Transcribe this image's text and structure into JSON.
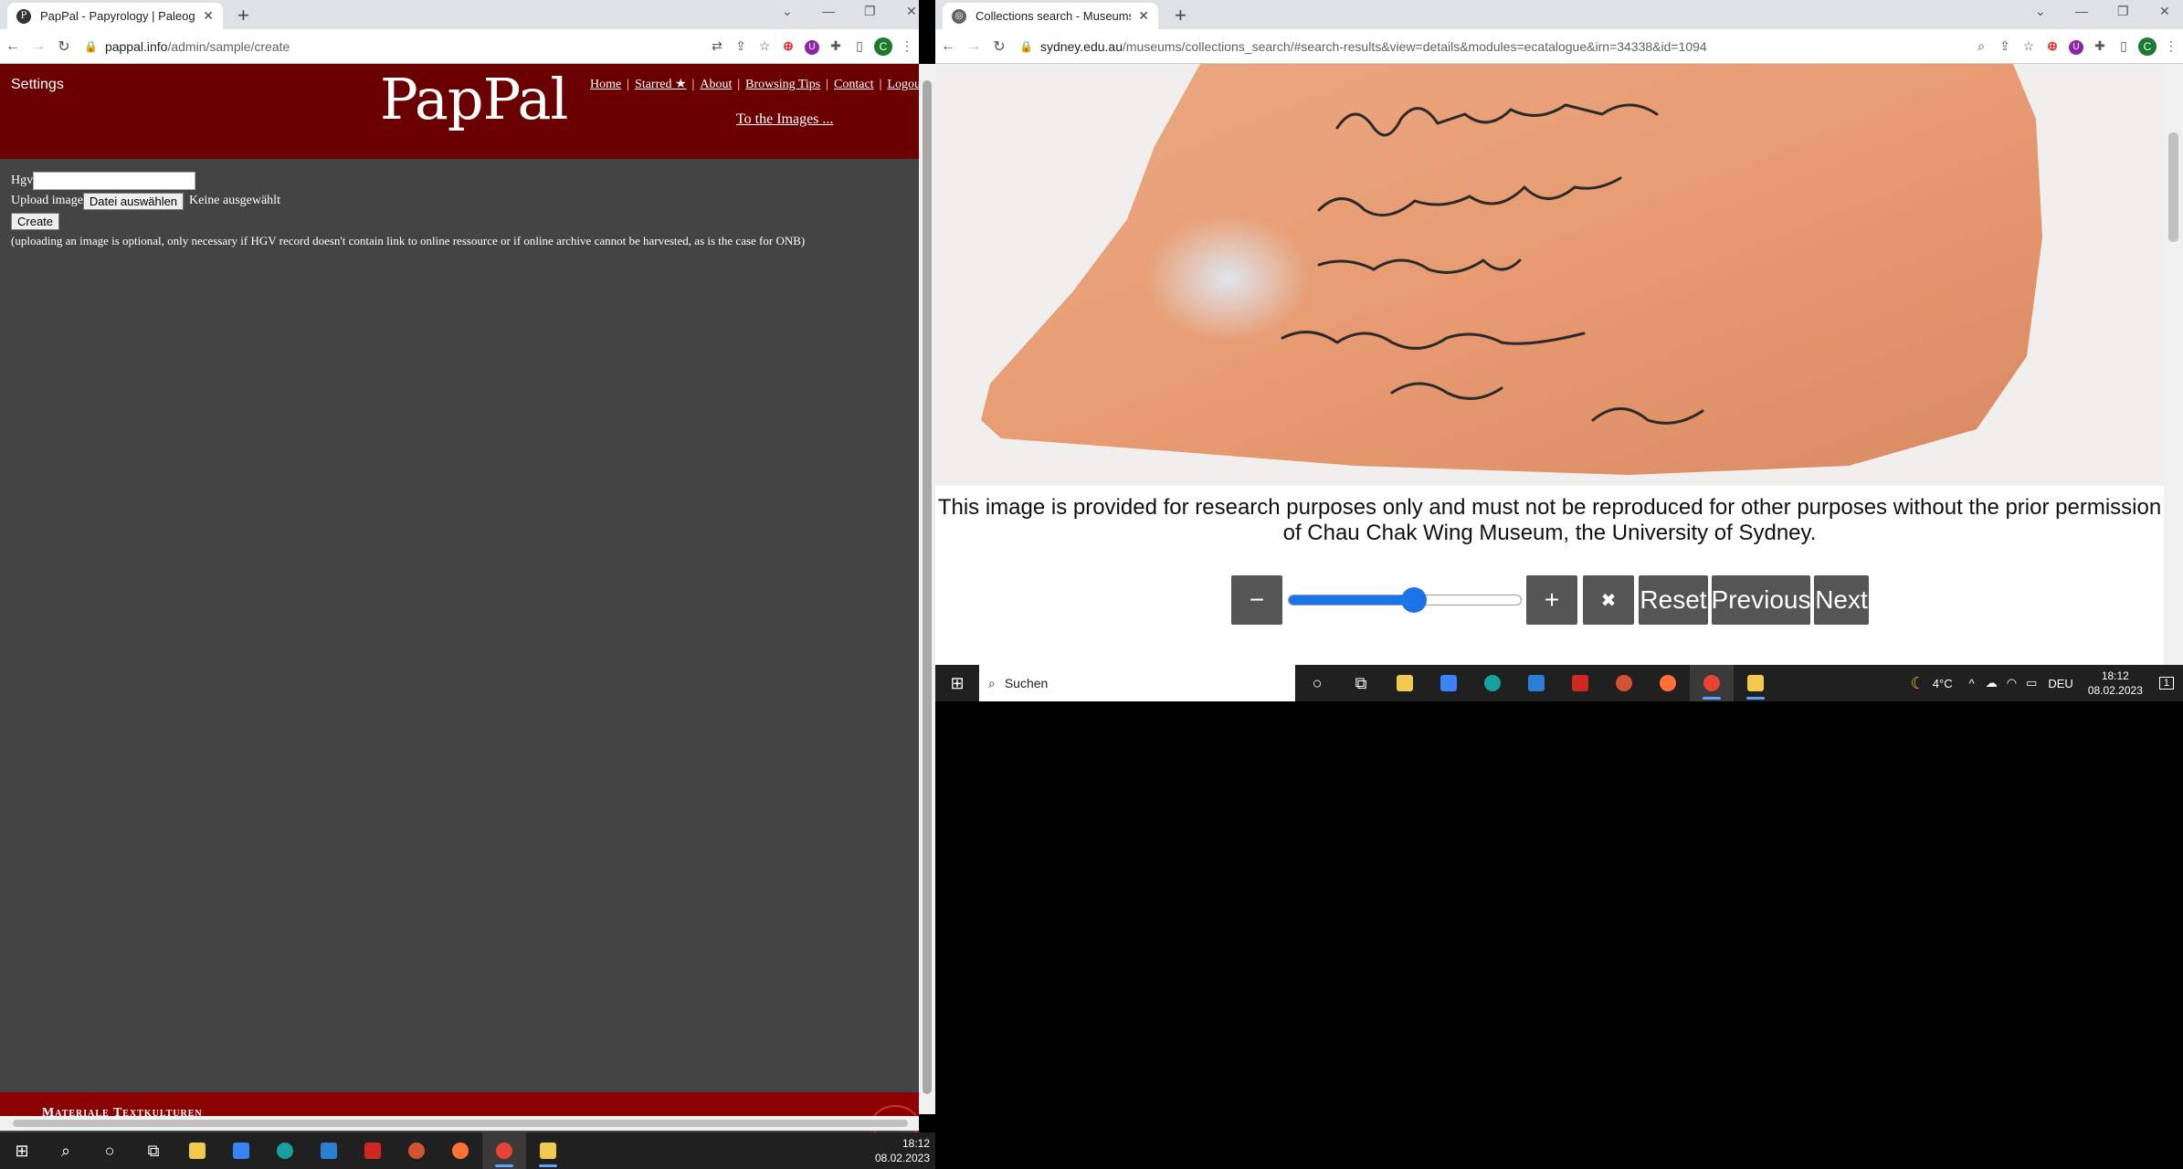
{
  "left_browser": {
    "tab_title": "PapPal - Papyrology | Paleograph",
    "url_host": "pappal.info",
    "url_path": "/admin/sample/create",
    "page": {
      "settings_label": "Settings",
      "logo": "PapPal",
      "nav": [
        "Home",
        "Starred ★",
        "About",
        "Browsing Tips",
        "Contact",
        "Logout"
      ],
      "nav_separator": "|",
      "to_images": "To the Images ...",
      "form": {
        "hgv_label": "Hgv",
        "hgv_value": "",
        "upload_label": "Upload image",
        "file_button": "Datei auswählen",
        "file_status": "Keine ausgewählt",
        "create_button": "Create",
        "note": "(uploading an image is optional, only necessary if HGV record doesn't contain link to online ressource or if online archive cannot be harvested, as is the case for ONB)"
      },
      "footer_text": "Materiale Textkulturen"
    },
    "profile_initial": "C"
  },
  "right_browser": {
    "tab_title": "Collections search - Museums - T",
    "url_host": "sydney.edu.au",
    "url_path": "/museums/collections_search/#search-results&view=details&modules=ecatalogue&irn=34338&id=1094",
    "caption": "This image is provided for research purposes only and must not be reproduced for other purposes without the prior permission of Chau Chak Wing Museum, the University of Sydney.",
    "controls": {
      "zoom_out": "−",
      "zoom_in": "+",
      "fullscreen_icon": "✖",
      "reset": "Reset",
      "previous": "Previous",
      "next": "Next",
      "zoom_level_fraction": 0.54
    },
    "profile_initial": "C"
  },
  "taskbar_left": {
    "time": "18:12",
    "date": "08.02.2023"
  },
  "taskbar_right": {
    "search_placeholder": "Suchen",
    "weather": "4°C",
    "language": "DEU",
    "time": "18:12",
    "date": "08.02.2023",
    "notification_count": "1"
  },
  "colors": {
    "pappal_red": "#6b0000",
    "page_bg": "#444444",
    "slider_blue": "#1a73e8",
    "ostracon": "#e8a07a"
  }
}
